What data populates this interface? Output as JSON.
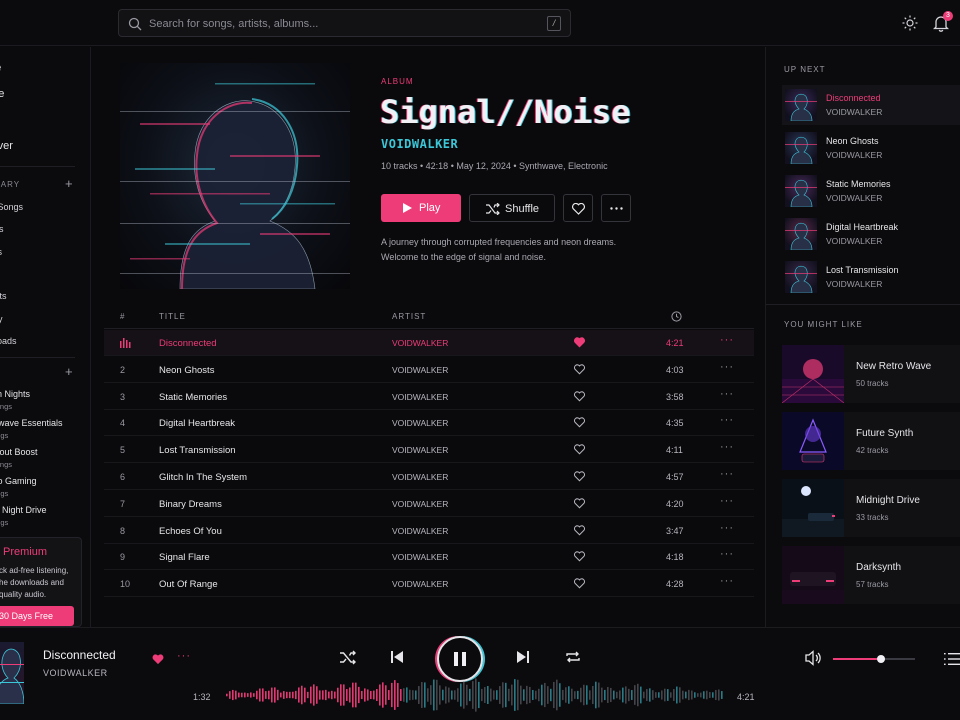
{
  "search": {
    "placeholder": "Search for songs, artists, albums...",
    "shortcut": "/"
  },
  "notifications": {
    "count": "3"
  },
  "sidebar": {
    "nav": [
      "me",
      "lore",
      "lio",
      "cover"
    ],
    "library_heading": "RARY",
    "library_items": [
      "d Songs",
      "ists",
      "ms",
      "ts",
      "asts",
      "ory",
      "nloads"
    ],
    "playlists_heading": "S",
    "playlists": [
      {
        "name": "on Nights",
        "sub": "songs"
      },
      {
        "name": "illwave Essentials",
        "sub": "ongs"
      },
      {
        "name": "rkout Boost",
        "sub": "songs"
      },
      {
        "name": "tro Gaming",
        "sub": "ongs"
      },
      {
        "name": "te Night Drive",
        "sub": "ongs"
      }
    ],
    "premium": {
      "title": "Premium",
      "desc": "ck ad-free listening, he downloads and quality audio.",
      "button": "30 Days Free"
    }
  },
  "album": {
    "tag": "ALBUM",
    "title": "Signal//Noise",
    "artist": "VOIDWALKER",
    "meta": "10 tracks  •  42:18  •  May 12, 2024  •  Synthwave, Electronic",
    "play_label": "Play",
    "shuffle_label": "Shuffle",
    "description": "A journey through corrupted frequencies and neon dreams. Welcome to the edge of signal and noise."
  },
  "table": {
    "headers": {
      "num": "#",
      "title": "TITLE",
      "artist": "ARTIST"
    },
    "tracks": [
      {
        "num": "",
        "title": "Disconnected",
        "artist": "VOIDWALKER",
        "duration": "4:21",
        "liked": true
      },
      {
        "num": "2",
        "title": "Neon Ghosts",
        "artist": "VOIDWALKER",
        "duration": "4:03",
        "liked": false
      },
      {
        "num": "3",
        "title": "Static Memories",
        "artist": "VOIDWALKER",
        "duration": "3:58",
        "liked": false
      },
      {
        "num": "4",
        "title": "Digital Heartbreak",
        "artist": "VOIDWALKER",
        "duration": "4:35",
        "liked": false
      },
      {
        "num": "5",
        "title": "Lost Transmission",
        "artist": "VOIDWALKER",
        "duration": "4:11",
        "liked": false
      },
      {
        "num": "6",
        "title": "Glitch In The System",
        "artist": "VOIDWALKER",
        "duration": "4:57",
        "liked": false
      },
      {
        "num": "7",
        "title": "Binary Dreams",
        "artist": "VOIDWALKER",
        "duration": "4:20",
        "liked": false
      },
      {
        "num": "8",
        "title": "Echoes Of You",
        "artist": "VOIDWALKER",
        "duration": "3:47",
        "liked": false
      },
      {
        "num": "9",
        "title": "Signal Flare",
        "artist": "VOIDWALKER",
        "duration": "4:18",
        "liked": false
      },
      {
        "num": "10",
        "title": "Out Of Range",
        "artist": "VOIDWALKER",
        "duration": "4:28",
        "liked": false
      }
    ]
  },
  "up_next": {
    "heading": "UP NEXT",
    "items": [
      {
        "title": "Disconnected",
        "artist": "VOIDWALKER"
      },
      {
        "title": "Neon Ghosts",
        "artist": "VOIDWALKER"
      },
      {
        "title": "Static Memories",
        "artist": "VOIDWALKER"
      },
      {
        "title": "Digital Heartbreak",
        "artist": "VOIDWALKER"
      },
      {
        "title": "Lost Transmission",
        "artist": "VOIDWALKER"
      }
    ]
  },
  "you_might_like": {
    "heading": "YOU MIGHT LIKE",
    "items": [
      {
        "title": "New Retro Wave",
        "count": "50 tracks"
      },
      {
        "title": "Future Synth",
        "count": "42 tracks"
      },
      {
        "title": "Midnight Drive",
        "count": "33 tracks"
      },
      {
        "title": "Darksynth",
        "count": "57 tracks"
      }
    ]
  },
  "player": {
    "title": "Disconnected",
    "artist": "VOIDWALKER",
    "elapsed": "1:32",
    "total": "4:21",
    "progress": 0.35,
    "volume": 0.58
  },
  "colors": {
    "accent": "#ee3c78",
    "cyan": "#3cc7d8",
    "background": "#0a0a0c"
  },
  "icons": [
    "search-icon",
    "sun-icon",
    "bell-icon",
    "play-icon",
    "shuffle-icon",
    "heart-icon",
    "more-icon",
    "clock-icon",
    "equalizer-icon",
    "prev-icon",
    "pause-icon",
    "next-icon",
    "repeat-icon",
    "volume-icon",
    "queue-icon"
  ]
}
